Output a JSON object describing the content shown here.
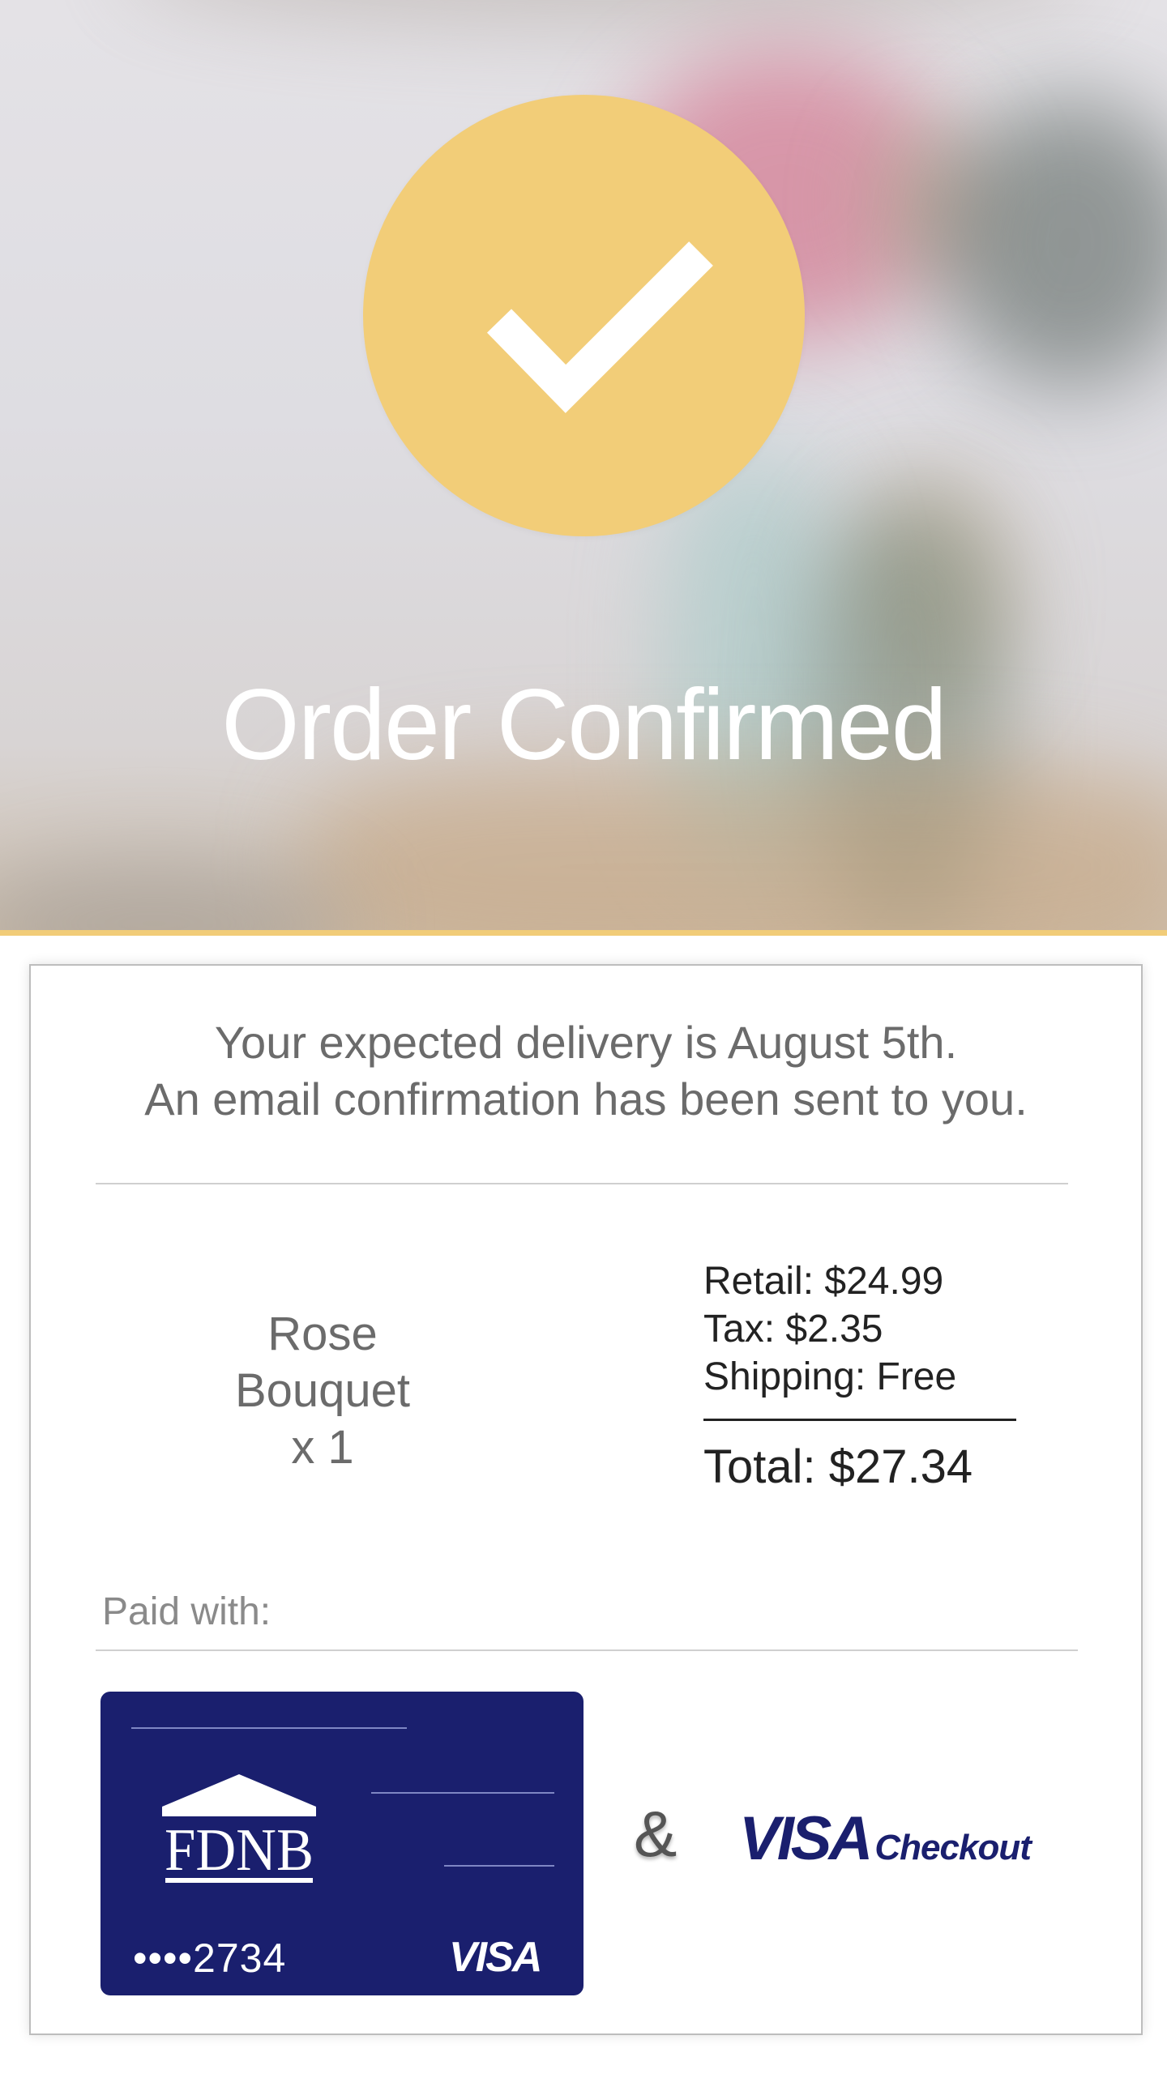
{
  "hero": {
    "title": "Order Confirmed"
  },
  "confirmation": {
    "delivery_line": "Your expected delivery is August 5th.",
    "email_line": "An email confirmation has been sent to you."
  },
  "order": {
    "item_name_line1": "Rose",
    "item_name_line2": "Bouquet",
    "quantity": "x 1",
    "retail": "Retail: $24.99",
    "tax": "Tax: $2.35",
    "shipping": "Shipping: Free",
    "total": "Total: $27.34"
  },
  "payment": {
    "label": "Paid with:",
    "card": {
      "bank_logo_text": "FDNB",
      "masked_number": "••••2734",
      "network": "VISA"
    },
    "ampersand": "&",
    "wallet": {
      "brand": "VISA",
      "product": "Checkout"
    }
  },
  "colors": {
    "accent_gold": "#f2cd78",
    "card_navy": "#1a1f6e",
    "text_gray": "#6b6b6b"
  },
  "icons": [
    "check-icon",
    "bank-building-icon"
  ]
}
